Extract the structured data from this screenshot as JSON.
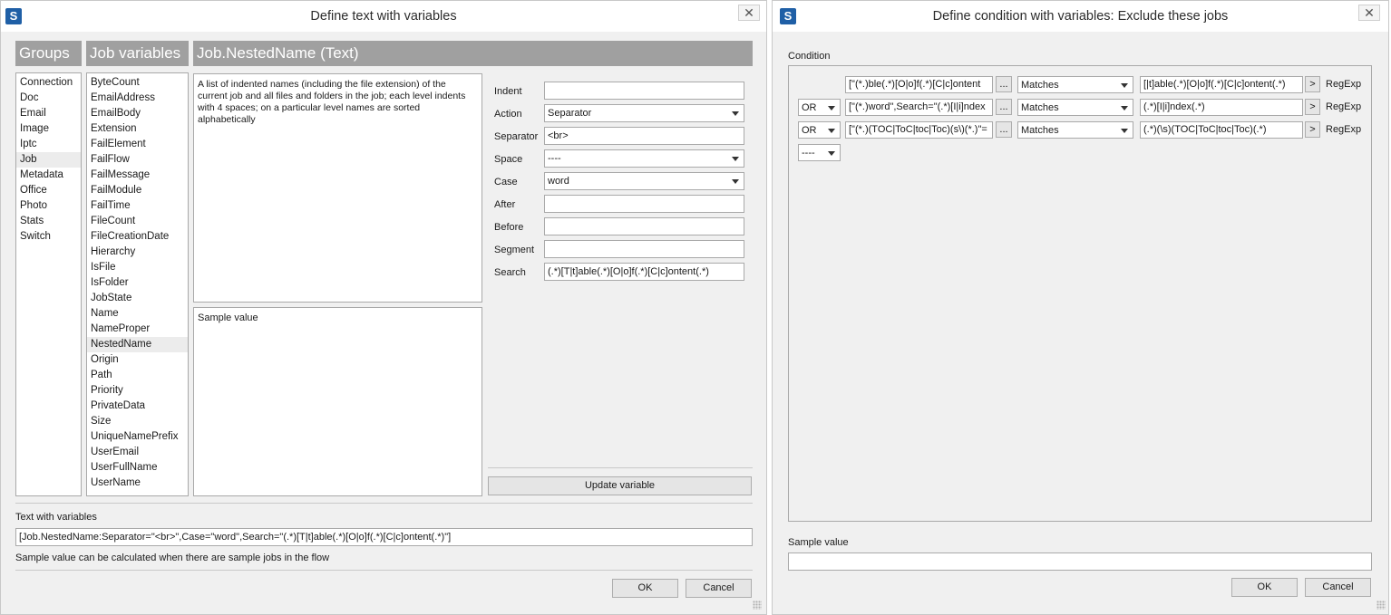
{
  "left_dialog": {
    "title": "Define text with variables",
    "close_glyph": "✕",
    "app_icon_letter": "S",
    "groups_header": "Groups",
    "groups": [
      "Connection",
      "Doc",
      "Email",
      "Image",
      "Iptc",
      "Job",
      "Metadata",
      "Office",
      "Photo",
      "Stats",
      "Switch"
    ],
    "job_variables_header": "Job variables",
    "job_variables": [
      "ByteCount",
      "EmailAddress",
      "EmailBody",
      "Extension",
      "FailElement",
      "FailFlow",
      "FailMessage",
      "FailModule",
      "FailTime",
      "FileCount",
      "FileCreationDate",
      "Hierarchy",
      "IsFile",
      "IsFolder",
      "JobState",
      "Name",
      "NameProper",
      "NestedName",
      "Origin",
      "Path",
      "Priority",
      "PrivateData",
      "Size",
      "UniqueNamePrefix",
      "UserEmail",
      "UserFullName",
      "UserName"
    ],
    "detail_header": "Job.NestedName (Text)",
    "description": "A list of indented names (including the file extension) of the current job and all files and folders in the job; each level indents with 4 spaces; on a particular level names are sorted alphabetically",
    "sample_value_label": "Sample value",
    "fields": {
      "indent_label": "Indent",
      "indent_value": "",
      "action_label": "Action",
      "action_value": "Separator",
      "separator_label": "Separator",
      "separator_value": "<br>",
      "space_label": "Space",
      "space_value": "----",
      "case_label": "Case",
      "case_value": "word",
      "after_label": "After",
      "after_value": "",
      "before_label": "Before",
      "before_value": "",
      "segment_label": "Segment",
      "segment_value": "",
      "search_label": "Search",
      "search_value": "(.*)[T|t]able(.*)[O|o]f(.*)[C|c]ontent(.*)"
    },
    "update_button": "Update variable",
    "text_with_variables_label": "Text with variables",
    "text_with_variables_value": "[Job.NestedName:Separator=\"<br>\",Case=\"word\",Search=\"(.*)[T|t]able(.*)[O|o]f(.*)[C|c]ontent(.*)\"]",
    "sample_note": "Sample value can be calculated when there are sample jobs in the flow",
    "ok_button": "OK",
    "cancel_button": "Cancel"
  },
  "right_dialog": {
    "title": "Define condition with variables: Exclude these jobs",
    "close_glyph": "✕",
    "app_icon_letter": "S",
    "condition_label": "Condition",
    "rows": [
      {
        "operator": "",
        "left": "ble(.*)[O|o]f(.*)[C|c]ontent(.*)\"]",
        "ellipsis": "...",
        "comparison": "Matches",
        "right": "[|t]able(.*)[O|o]f(.*)[C|c]ontent(.*)",
        "arrow": ">",
        "type": "RegExp"
      },
      {
        "operator": "OR",
        "left": "word\",Search=\"(.*)[I|i]ndex(.*)\"]",
        "ellipsis": "...",
        "comparison": "Matches",
        "right": "(.*)[I|i]ndex(.*)",
        "arrow": ">",
        "type": "RegExp"
      },
      {
        "operator": "OR",
        "left": "=\"(.*)(\\s)(TOC|ToC|toc|Toc)(.*)\"]",
        "ellipsis": "...",
        "comparison": "Matches",
        "right": "(.*)(\\s)(TOC|ToC|toc|Toc)(.*)",
        "arrow": ">",
        "type": "RegExp"
      }
    ],
    "empty_operator": "----",
    "sample_value_label": "Sample value",
    "sample_value": "",
    "ok_button": "OK",
    "cancel_button": "Cancel"
  }
}
